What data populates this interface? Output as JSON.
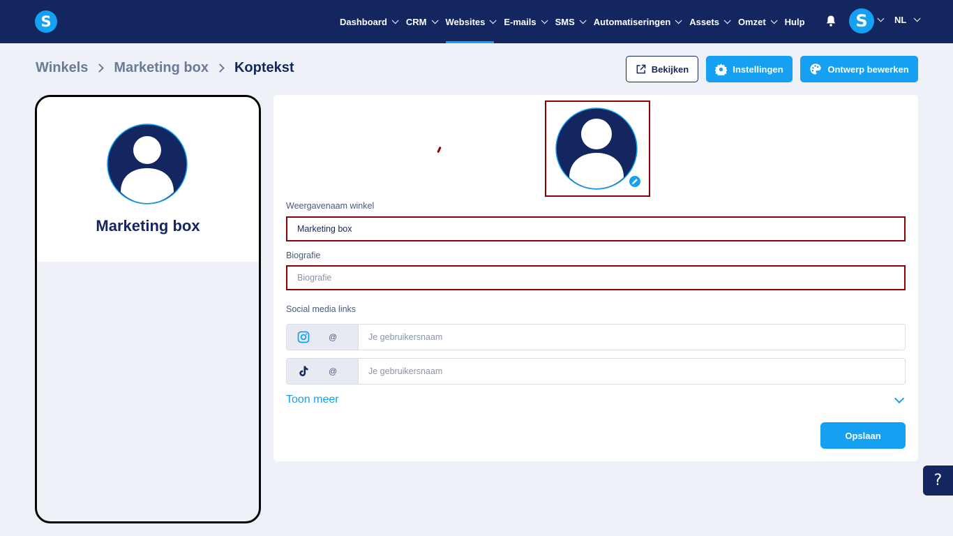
{
  "brand": {
    "logo_letter": "S"
  },
  "nav": {
    "items": [
      {
        "label": "Dashboard",
        "dropdown": true
      },
      {
        "label": "CRM",
        "dropdown": true
      },
      {
        "label": "Websites",
        "dropdown": true,
        "active": true
      },
      {
        "label": "E-mails",
        "dropdown": true
      },
      {
        "label": "SMS",
        "dropdown": true
      },
      {
        "label": "Automatiseringen",
        "dropdown": true
      },
      {
        "label": "Assets",
        "dropdown": true
      },
      {
        "label": "Omzet",
        "dropdown": true
      },
      {
        "label": "Hulp",
        "dropdown": false
      }
    ],
    "user_initial": "S",
    "language": "NL"
  },
  "breadcrumb": [
    "Winkels",
    "Marketing box",
    "Koptekst"
  ],
  "actions": {
    "view_label": "Bekijken",
    "settings_label": "Instellingen",
    "design_label": "Ontwerp bewerken"
  },
  "preview": {
    "store_name": "Marketing box"
  },
  "form": {
    "display_name_label": "Weergavenaam winkel",
    "display_name_value": "Marketing box",
    "bio_label": "Biografie",
    "bio_placeholder": "Biografie",
    "social_label": "Social media links",
    "socials": [
      {
        "icon": "instagram-icon",
        "prefix": "@",
        "placeholder": "Je gebruikersnaam"
      },
      {
        "icon": "tiktok-icon",
        "prefix": "@",
        "placeholder": "Je gebruikersnaam"
      }
    ],
    "show_more_label": "Toon meer",
    "save_label": "Opslaan"
  },
  "help": {
    "label": "?"
  },
  "colors": {
    "navy": "#14265f",
    "accent": "#15a0f2",
    "highlight": "#8b0000",
    "background": "#eef2f8"
  }
}
